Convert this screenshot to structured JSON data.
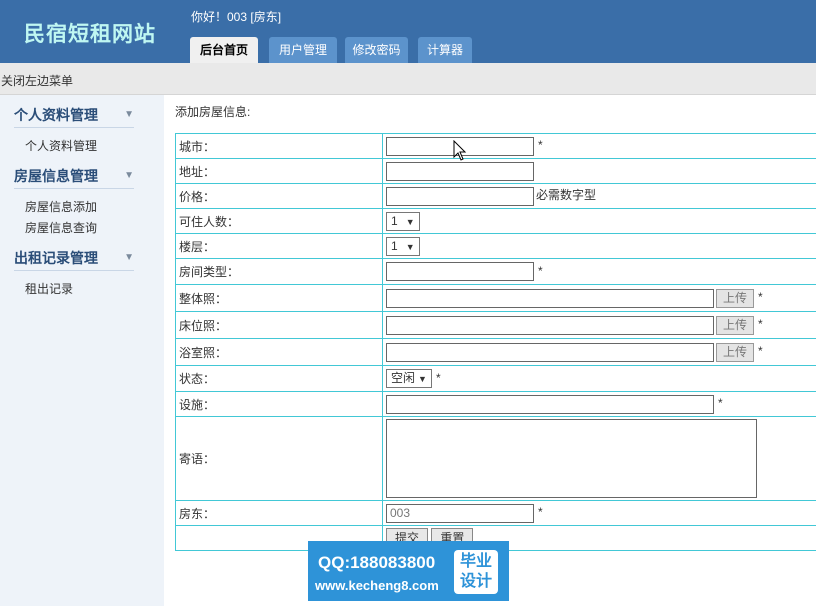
{
  "header": {
    "logo": "民宿短租网站",
    "greeting": "你好！003 [房东]",
    "tabs": [
      "后台首页",
      "用户管理",
      "修改密码",
      "计算器"
    ]
  },
  "toggle_menu": "关闭左边菜单",
  "sidebar": {
    "groups": [
      {
        "title": "个人资料管理",
        "items": [
          "个人资料管理"
        ]
      },
      {
        "title": "房屋信息管理",
        "items": [
          "房屋信息添加",
          "房屋信息查询"
        ]
      },
      {
        "title": "出租记录管理",
        "items": [
          "租出记录"
        ]
      }
    ]
  },
  "main": {
    "title": "添加房屋信息:",
    "fields": {
      "city": {
        "label": "城市：",
        "value": "",
        "required": "*"
      },
      "address": {
        "label": "地址：",
        "value": ""
      },
      "price": {
        "label": "价格：",
        "value": "",
        "note": "必需数字型"
      },
      "capacity": {
        "label": "可住人数：",
        "selected": "1"
      },
      "floor": {
        "label": "楼层：",
        "selected": "1"
      },
      "room_type": {
        "label": "房间类型：",
        "value": "",
        "required": "*"
      },
      "whole_photo": {
        "label": "整体照：",
        "value": "",
        "button": "上传",
        "required": "*"
      },
      "bed_photo": {
        "label": "床位照：",
        "value": "",
        "button": "上传",
        "required": "*"
      },
      "bath_photo": {
        "label": "浴室照：",
        "value": "",
        "button": "上传",
        "required": "*"
      },
      "status": {
        "label": "状态：",
        "selected": "空闲",
        "required": "*"
      },
      "facilities": {
        "label": "设施：",
        "value": "",
        "required": "*"
      },
      "message": {
        "label": "寄语：",
        "value": ""
      },
      "landlord": {
        "label": "房东：",
        "value": "003",
        "required": "*"
      }
    },
    "buttons": {
      "submit": "提交",
      "reset": "重置"
    }
  },
  "watermark": {
    "qq": "QQ:188083800",
    "url": "www.kecheng8.com",
    "badge_line1": "毕业",
    "badge_line2": "设计"
  },
  "colors": {
    "header_bg": "#3a6ea8",
    "logo": "#bff7f2",
    "tab_inactive": "#5c93cc",
    "sidebar_bg": "#eef3f9",
    "table_border": "#42c8d6",
    "watermark_bg": "#2e93d8"
  }
}
